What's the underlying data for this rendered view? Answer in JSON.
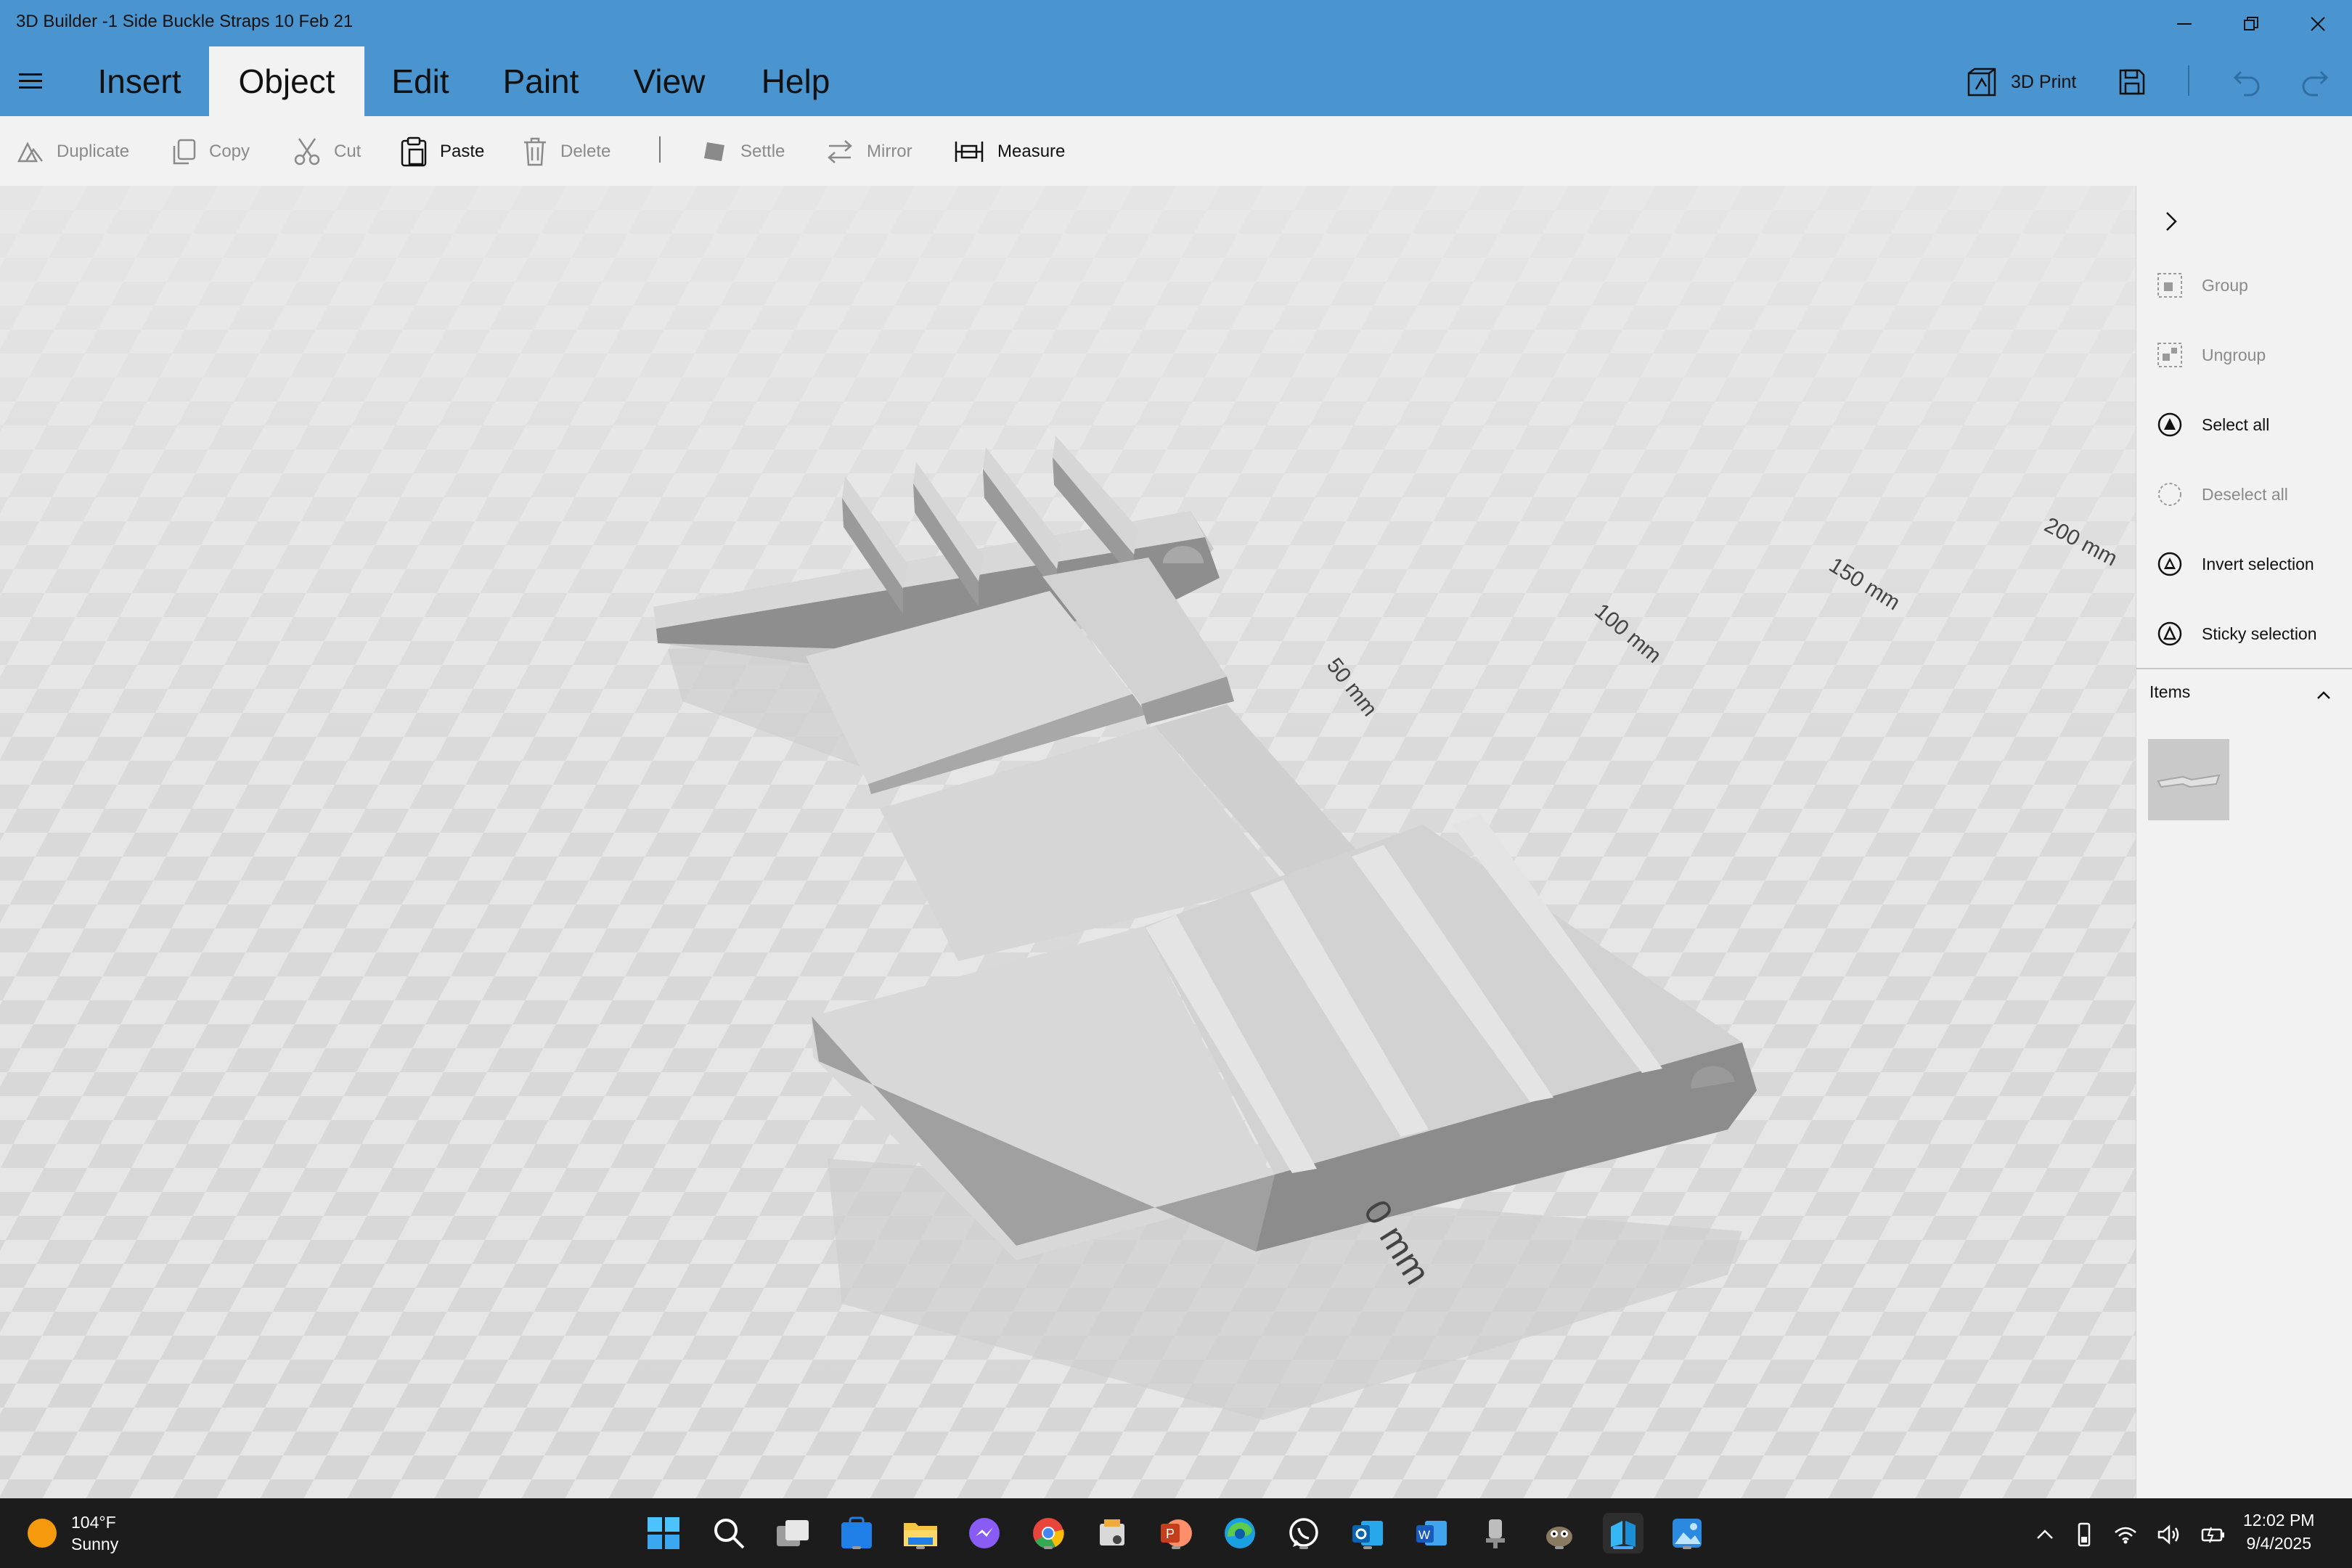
{
  "window": {
    "title": "3D Builder -1 Side Buckle Straps 10 Feb 21"
  },
  "menu": {
    "tabs": [
      {
        "label": "Insert"
      },
      {
        "label": "Object"
      },
      {
        "label": "Edit"
      },
      {
        "label": "Paint"
      },
      {
        "label": "View"
      },
      {
        "label": "Help"
      }
    ],
    "active_tab": "Object",
    "print_label": "3D Print"
  },
  "toolbar": {
    "duplicate": "Duplicate",
    "copy": "Copy",
    "cut": "Cut",
    "paste": "Paste",
    "delete": "Delete",
    "settle": "Settle",
    "mirror": "Mirror",
    "measure": "Measure"
  },
  "viewport": {
    "scale_labels": [
      "50 mm",
      "100 mm",
      "150 mm",
      "200 mm",
      "0 mm"
    ]
  },
  "panel": {
    "items": [
      {
        "label": "Group",
        "enabled": false
      },
      {
        "label": "Ungroup",
        "enabled": false
      },
      {
        "label": "Select all",
        "enabled": true
      },
      {
        "label": "Deselect all",
        "enabled": false
      },
      {
        "label": "Invert selection",
        "enabled": true
      },
      {
        "label": "Sticky selection",
        "enabled": true
      }
    ],
    "items_section_label": "Items"
  },
  "taskbar": {
    "weather_temp": "104°F",
    "weather_desc": "Sunny",
    "time": "12:02 PM",
    "date": "9/4/2025",
    "apps": [
      "start",
      "search",
      "task-view",
      "store",
      "file-explorer",
      "messenger",
      "chrome",
      "snipping",
      "powerpoint",
      "edge",
      "whatsapp",
      "outlook",
      "word",
      "recorder",
      "gimp",
      "3d-builder",
      "photos"
    ]
  },
  "colors": {
    "titlebar": "#4a95d0",
    "toolbar": "#f2f2f2",
    "model": "#bdbdbd",
    "taskbar": "#1c1c1c"
  }
}
